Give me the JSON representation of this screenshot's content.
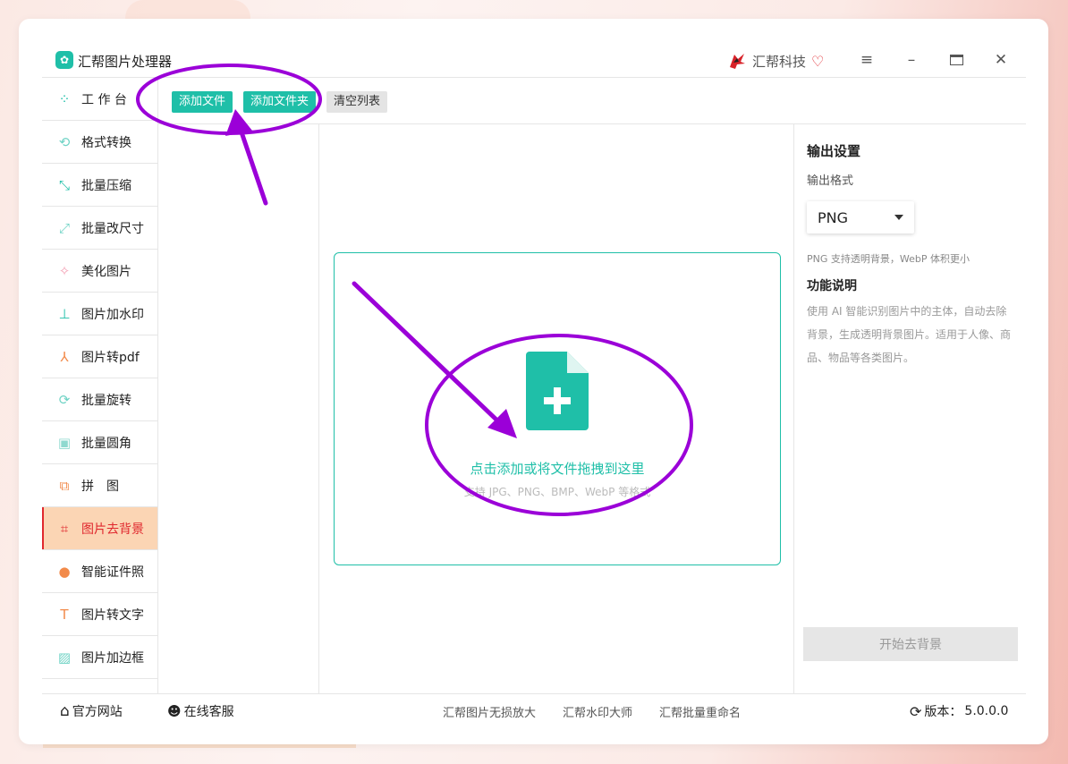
{
  "window": {
    "title": "汇帮图片处理器",
    "brand": "汇帮科技"
  },
  "controls": {
    "menu_icon": "menu-icon",
    "minimize_icon": "minimize-icon",
    "maximize_icon": "maximize-icon",
    "close_icon": "close-icon"
  },
  "toolbar": {
    "add_file": "添加文件",
    "add_folder": "添加文件夹",
    "clear_list": "清空列表"
  },
  "sidebar": {
    "items": [
      {
        "label": "工 作 台",
        "icon": "grid-icon",
        "active": false
      },
      {
        "label": "格式转换",
        "icon": "convert-icon",
        "active": false
      },
      {
        "label": "批量压缩",
        "icon": "compress-icon",
        "active": false
      },
      {
        "label": "批量改尺寸",
        "icon": "resize-icon",
        "active": false
      },
      {
        "label": "美化图片",
        "icon": "beautify-icon",
        "active": false
      },
      {
        "label": "图片加水印",
        "icon": "stamp-icon",
        "active": false
      },
      {
        "label": "图片转pdf",
        "icon": "pdf-icon",
        "active": false
      },
      {
        "label": "批量旋转",
        "icon": "rotate-icon",
        "active": false
      },
      {
        "label": "批量圆角",
        "icon": "image-icon",
        "active": false
      },
      {
        "label": "拼　图",
        "icon": "collage-icon",
        "active": false
      },
      {
        "label": "图片去背景",
        "icon": "crop-icon",
        "active": true
      },
      {
        "label": "智能证件照",
        "icon": "person-icon",
        "active": false
      },
      {
        "label": "图片转文字",
        "icon": "text-icon",
        "active": false
      },
      {
        "label": "图片加边框",
        "icon": "frame-icon",
        "active": false
      }
    ]
  },
  "dropzone": {
    "title": "点击添加或将文件拖拽到这里",
    "subtitle": "支持 JPG、PNG、BMP、WebP 等格式"
  },
  "panel": {
    "heading": "输出设置",
    "format_label": "输出格式",
    "format_value": "PNG",
    "format_note": "PNG 支持透明背景，WebP 体积更小",
    "func_heading": "功能说明",
    "func_desc": "使用 AI 智能识别图片中的主体，自动去除背景，生成透明背景图片。适用于人像、商品、物品等各类图片。",
    "start_button": "开始去背景"
  },
  "footer": {
    "website": "官方网站",
    "support": "在线客服",
    "links": [
      "汇帮图片无损放大",
      "汇帮水印大师",
      "汇帮批量重命名"
    ],
    "version_label": "版本：",
    "version": "5.0.0.0"
  },
  "colors": {
    "accent": "#1fbfa8",
    "active_bg": "#fbd5b4",
    "active_text": "#e0282e",
    "annotation": "#9b00d8"
  }
}
